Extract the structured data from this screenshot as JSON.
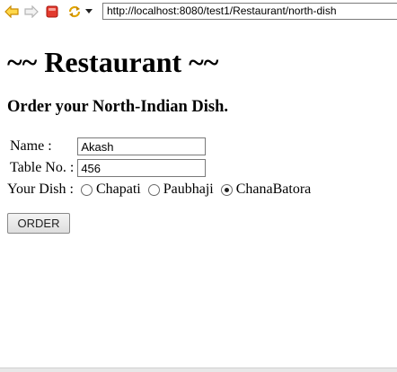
{
  "browser": {
    "url": "http://localhost:8080/test1/Restaurant/north-dish",
    "icons": [
      "back-arrow-icon",
      "forward-arrow-icon",
      "stop-icon",
      "refresh-icon",
      "dropdown-arrow-icon"
    ],
    "colors": {
      "back_arrow": "#e0a400",
      "stop": "#d8241c",
      "refresh": "#e0a400"
    }
  },
  "page": {
    "title": "~~ Restaurant ~~",
    "subtitle": "Order your North-Indian Dish."
  },
  "form": {
    "name_label": "Name :",
    "name_value": "Akash",
    "table_label": "Table No. :",
    "table_value": "456",
    "dish_label": "Your Dish :",
    "dishes": [
      {
        "label": "Chapati",
        "selected": false
      },
      {
        "label": "Paubhaji",
        "selected": false
      },
      {
        "label": "ChanaBatora",
        "selected": true
      }
    ],
    "submit_label": "ORDER"
  }
}
